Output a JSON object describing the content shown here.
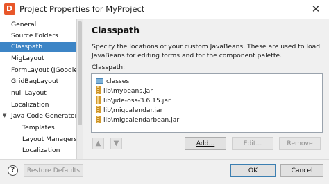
{
  "window": {
    "title": "Project Properties for MyProject",
    "app_icon": "D",
    "close_glyph": "✕"
  },
  "sidebar": {
    "items": [
      {
        "label": "General"
      },
      {
        "label": "Source Folders"
      },
      {
        "label": "Classpath",
        "selected": true
      },
      {
        "label": "MigLayout"
      },
      {
        "label": "FormLayout (JGoodies)"
      },
      {
        "label": "GridBagLayout"
      },
      {
        "label": "null Layout"
      },
      {
        "label": "Localization"
      },
      {
        "label": "Java Code Generator",
        "expanded": true
      },
      {
        "label": "Templates"
      },
      {
        "label": "Layout Managers"
      },
      {
        "label": "Localization"
      }
    ]
  },
  "main": {
    "title": "Classpath",
    "description": "Specify the locations of your custom JavaBeans. These are used to load JavaBeans for editing forms and for the component palette.",
    "classpath_label": "Classpath:",
    "entries": [
      {
        "icon": "folder-icon",
        "path": "classes"
      },
      {
        "icon": "jar-icon",
        "path": "lib\\mybeans.jar"
      },
      {
        "icon": "jar-icon",
        "path": "lib\\jide-oss-3.6.15.jar"
      },
      {
        "icon": "jar-icon",
        "path": "lib\\migcalendar.jar"
      },
      {
        "icon": "jar-icon",
        "path": "lib\\migcalendarbean.jar"
      }
    ],
    "buttons": {
      "move_up": "▲",
      "move_down": "▼",
      "add": "Add...",
      "edit": "Edit...",
      "remove": "Remove"
    }
  },
  "footer": {
    "help": "?",
    "restore_defaults": "Restore Defaults",
    "ok": "OK",
    "cancel": "Cancel"
  },
  "colors": {
    "selection": "#3d85c6",
    "window_bg": "#f0f0f0",
    "accent_logo": "#e8572a"
  }
}
